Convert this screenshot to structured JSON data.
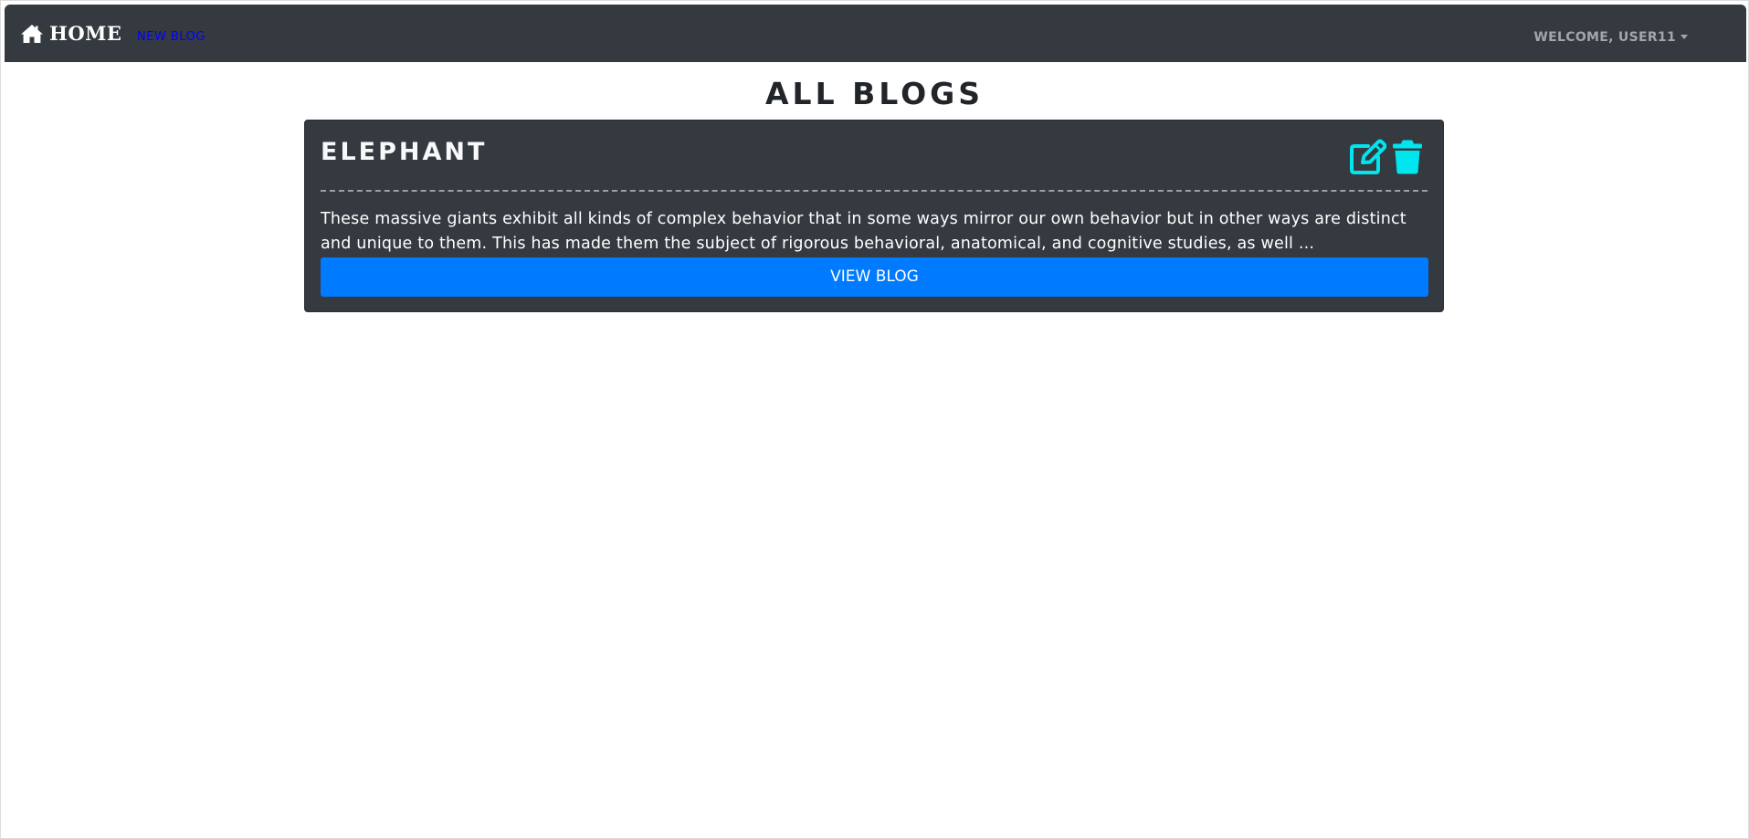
{
  "navbar": {
    "brand_label": "HOME",
    "brand_icon": "home-icon",
    "new_blog_label": "NEW BLOG",
    "user_menu_label": "WELCOME, USER11",
    "background_color": "#343a40"
  },
  "main": {
    "title": "ALL BLOGS",
    "blogs": [
      {
        "title": "ELEPHANT",
        "excerpt": "These massive giants exhibit all kinds of complex behavior that in some ways mirror our own behavior but in other ways are distinct and unique to them. This has made them the subject of rigorous behavioral, anatomical, and cognitive studies, as well ...",
        "view_button_label": "VIEW BLOG",
        "edit_icon": "edit-icon",
        "delete_icon": "trash-icon"
      }
    ]
  },
  "colors": {
    "accent_icon": "#00e5ee",
    "primary_button": "#007bff",
    "card_background": "#343a40",
    "new_blog_link": "#0000ff"
  }
}
